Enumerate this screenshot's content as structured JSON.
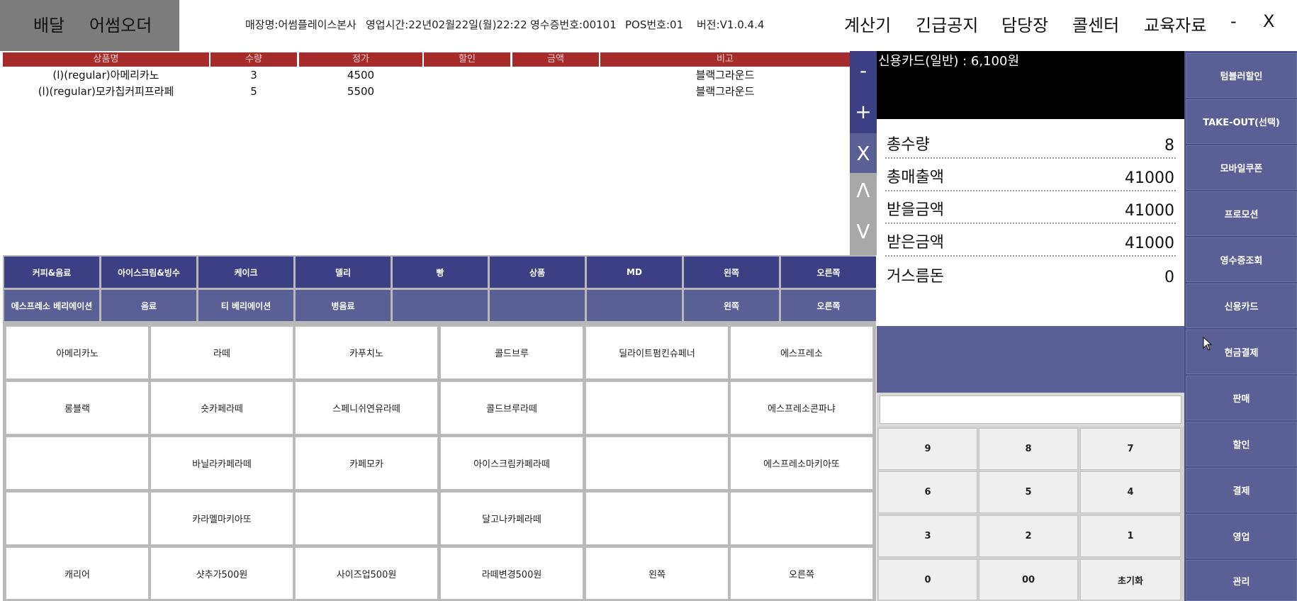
{
  "mode": {
    "delivery": "배달",
    "order": "어썸오더"
  },
  "info": {
    "store": "매장명:어썸플레이스본사",
    "business_time": "영업시간:22년02월22일(월)22:22",
    "receipt_no": "영수증번호:00101",
    "pos_no": "POS번호:01",
    "version": "버전:V1.0.4.4"
  },
  "top_menu": {
    "calculator": "계산기",
    "notice": "긴급공지",
    "manager": "담당장",
    "callcenter": "콜센터",
    "education": "교육자료",
    "minimize": "-",
    "close": "X"
  },
  "order_table": {
    "headers": [
      "상품명",
      "수량",
      "정가",
      "할인",
      "금액",
      "비고"
    ],
    "rows": [
      {
        "name": "(l)(regular)아메리카노",
        "qty": "3",
        "price": "4500",
        "discount": "",
        "amount": "",
        "note": "블랙그라운드"
      },
      {
        "name": "(l)(regular)모카칩커피프라페",
        "qty": "5",
        "price": "5500",
        "discount": "",
        "amount": "",
        "note": "블랙그라운드"
      }
    ]
  },
  "side_controls": {
    "minus": "-",
    "plus": "+",
    "remove": "X",
    "up": "Λ",
    "down": "V"
  },
  "payment_display": {
    "card_text": "신용카드(일반) : 6,100원"
  },
  "summary": {
    "total_qty_label": "총수량",
    "total_qty": "8",
    "total_sales_label": "총매출액",
    "total_sales": "41000",
    "to_receive_label": "받을금액",
    "to_receive": "41000",
    "received_label": "받은금액",
    "received": "41000",
    "change_label": "거스름돈",
    "change": "0"
  },
  "functions": [
    "텀블러할인",
    "TAKE-OUT(선택)",
    "모바일쿠폰",
    "프로모션",
    "영수증조회",
    "신용카드",
    "현금결제",
    "판매",
    "할인",
    "결제",
    "영업",
    "관리"
  ],
  "categories_row1": [
    "커피&음료",
    "아이스크림&빙수",
    "케이크",
    "델리",
    "빵",
    "상품",
    "MD",
    "왼쪽",
    "오른쪽"
  ],
  "categories_row2": [
    "에스프레소 베리에이션",
    "음료",
    "티 베리에이션",
    "병음료",
    "",
    "",
    "",
    "왼쪽",
    "오른쪽"
  ],
  "products": [
    [
      "아메리카노",
      "라떼",
      "카푸치노",
      "콜드브루",
      "딜라이트펌킨슈페너",
      "에스프레소"
    ],
    [
      "롱블랙",
      "숏카페라떼",
      "스페니쉬연유라떼",
      "콜드브루라떼",
      "",
      "에스프레소콘파냐"
    ],
    [
      "",
      "바닐라카페라떼",
      "카페모카",
      "아이스크림카페라떼",
      "",
      "에스프레소마키아또"
    ],
    [
      "",
      "카라멜마키아또",
      "",
      "달고나카페라떼",
      "",
      ""
    ],
    [
      "캐리어",
      "샷추가500원",
      "사이즈업500원",
      "라떼변경500원",
      "왼쪽",
      "오른쪽"
    ]
  ],
  "numpad": {
    "rows": [
      [
        "9",
        "8",
        "7"
      ],
      [
        "6",
        "5",
        "4"
      ],
      [
        "3",
        "2",
        "1"
      ],
      [
        "0",
        "00",
        "초기화"
      ]
    ]
  },
  "colors": {
    "header_red": "#a62b2b",
    "navy": "#3c3f83",
    "purple": "#5a5f96",
    "side_light": "#a8a8a8"
  }
}
